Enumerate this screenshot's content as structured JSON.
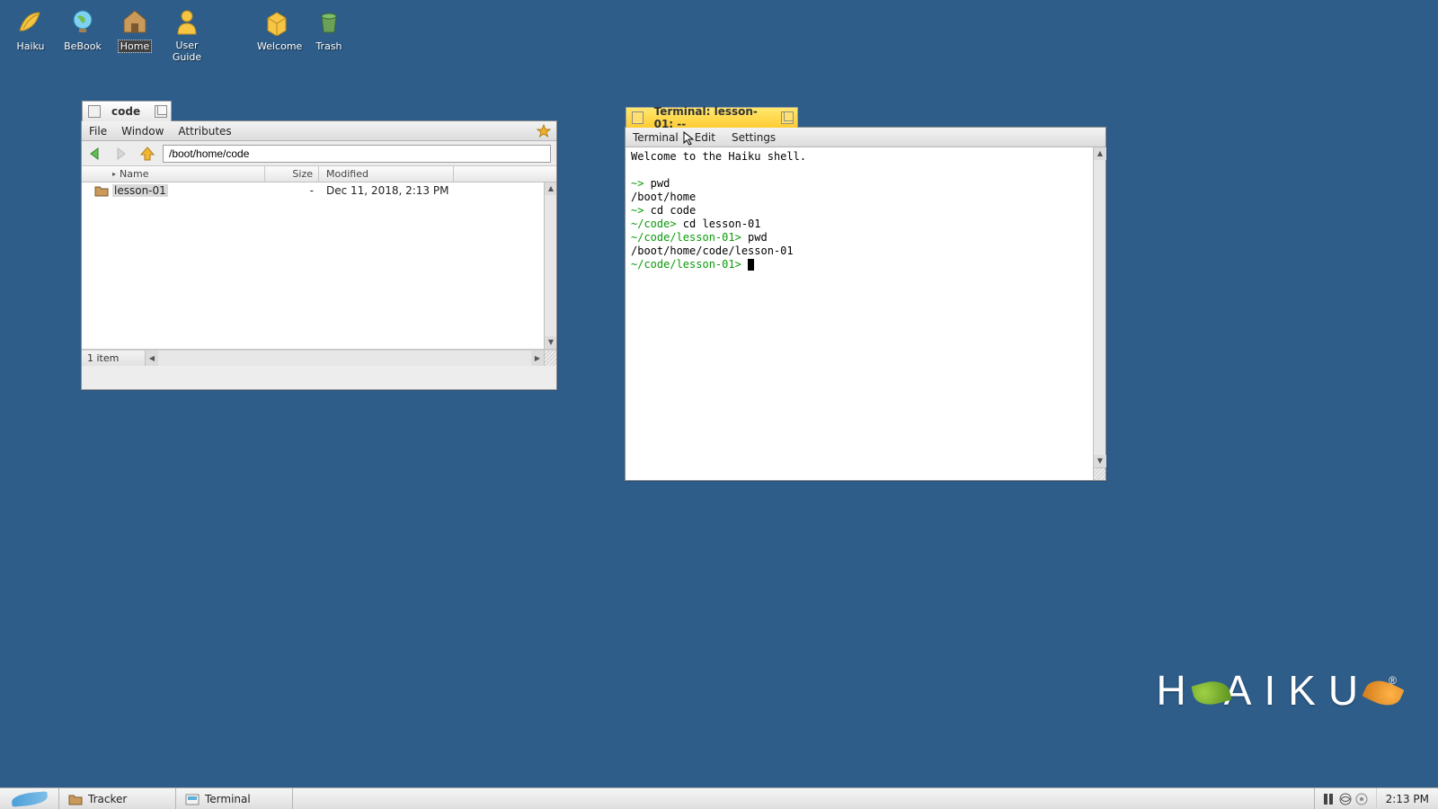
{
  "desktop": {
    "icons": [
      {
        "label": "Haiku"
      },
      {
        "label": "BeBook"
      },
      {
        "label": "Home"
      },
      {
        "label": "User Guide"
      },
      {
        "label": "Welcome"
      },
      {
        "label": "Trash"
      }
    ],
    "selected": "Home"
  },
  "tracker": {
    "title": "code",
    "menu": {
      "file": "File",
      "window": "Window",
      "attributes": "Attributes"
    },
    "path": "/boot/home/code",
    "columns": {
      "name": "Name",
      "size": "Size",
      "modified": "Modified"
    },
    "rows": [
      {
        "name": "lesson-01",
        "size": "-",
        "modified": "Dec 11, 2018, 2:13 PM"
      }
    ],
    "status": "1 item"
  },
  "terminal": {
    "title": "Terminal: lesson-01: --",
    "menu": {
      "terminal": "Terminal",
      "edit": "Edit",
      "settings": "Settings"
    },
    "lines": [
      {
        "prompt": "",
        "text": "Welcome to the Haiku shell."
      },
      {
        "prompt": "",
        "text": ""
      },
      {
        "prompt": "~>",
        "text": " pwd"
      },
      {
        "prompt": "",
        "text": "/boot/home"
      },
      {
        "prompt": "~>",
        "text": " cd code"
      },
      {
        "prompt": "~/code>",
        "text": " cd lesson-01"
      },
      {
        "prompt": "~/code/lesson-01>",
        "text": " pwd"
      },
      {
        "prompt": "",
        "text": "/boot/home/code/lesson-01"
      },
      {
        "prompt": "~/code/lesson-01>",
        "text": " ",
        "cursor": true
      }
    ]
  },
  "logo": {
    "text": "HAIKU",
    "registered": "®"
  },
  "taskbar": {
    "items": [
      {
        "label": "Tracker"
      },
      {
        "label": "Terminal"
      }
    ],
    "clock": "2:13 PM"
  }
}
